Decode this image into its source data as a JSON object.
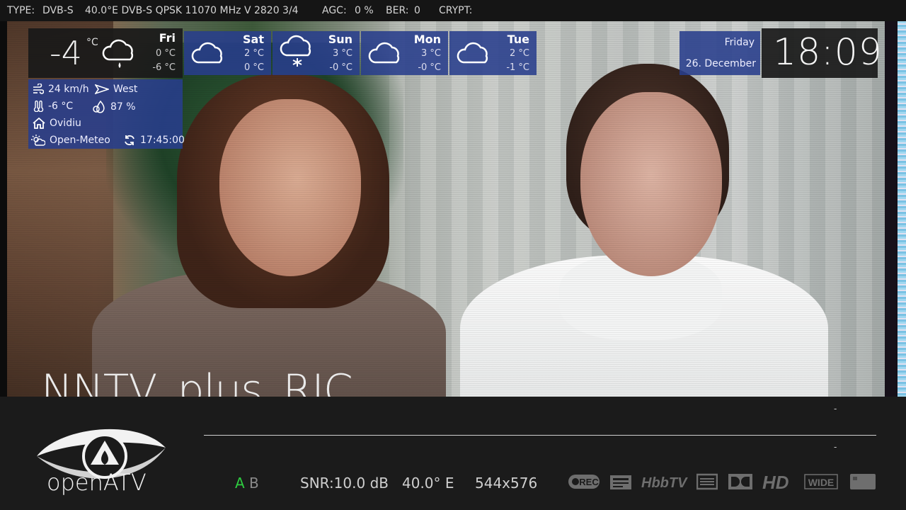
{
  "top_bar": {
    "type_label": "TYPE:",
    "type_value": "DVB-S",
    "tuner_info": "40.0°E DVB-S QPSK 11070 MHz V 2820 3/4",
    "agc_label": "AGC:",
    "agc_value": "0 %",
    "ber_label": "BER:",
    "ber_value": "0",
    "crypt_label": "CRYPT:"
  },
  "channel": {
    "name": "NNTV_plus_RIC"
  },
  "weather": {
    "current": {
      "temp": "-4",
      "unit": "°C",
      "icon": "cloud-rain-icon",
      "day": "Fri",
      "high": "0 °C",
      "low": "-6 °C"
    },
    "forecast": [
      {
        "day": "Sat",
        "high": "2 °C",
        "low": "0 °C",
        "icon": "cloud-icon"
      },
      {
        "day": "Sun",
        "high": "3 °C",
        "low": "-0 °C",
        "icon": "cloud-snow-icon"
      },
      {
        "day": "Mon",
        "high": "3 °C",
        "low": "-0 °C",
        "icon": "cloud-icon"
      },
      {
        "day": "Tue",
        "high": "2 °C",
        "low": "-1 °C",
        "icon": "cloud-icon"
      }
    ],
    "details": {
      "wind_speed": "24 km/h",
      "wind_dir": "West",
      "feels_like": "-6 °C",
      "humidity": "87 %",
      "location": "Ovidiu",
      "provider": "Open-Meteo",
      "updated": "17:45:00"
    }
  },
  "datetime": {
    "weekday": "Friday",
    "date": "26. December",
    "time": "18:09"
  },
  "bottom": {
    "logo_text": "openATV",
    "now_dash": "-",
    "next_dash": "-",
    "audio_a": "A",
    "audio_b": "B",
    "snr": "SNR:10.0 dB",
    "orbital": "40.0° E",
    "resolution": "544x576",
    "flags": [
      "rec-icon",
      "teletext-icon",
      "hbbtv-icon",
      "subtitle-icon",
      "dolby-icon",
      "hd-icon",
      "wide-icon",
      "crypt-card-icon"
    ],
    "flag_labels": {
      "rec": "REC",
      "hbbtv": "HbbTV",
      "hd": "HD",
      "wide": "WIDE"
    }
  },
  "colors": {
    "panel_blue": "#283e8c",
    "panel_dark": "#191919",
    "audio_active": "#2ecc40"
  }
}
